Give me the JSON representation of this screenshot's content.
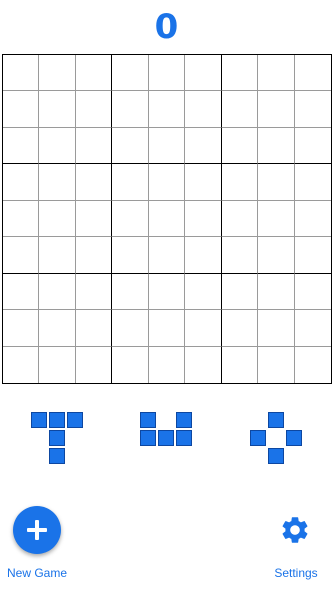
{
  "score": "0",
  "board": {
    "rows": 9,
    "cols": 9,
    "filled": []
  },
  "pieces": [
    {
      "name": "t-piece",
      "shape": [
        [
          1,
          1,
          1
        ],
        [
          0,
          1,
          0
        ],
        [
          0,
          1,
          0
        ]
      ]
    },
    {
      "name": "u-piece",
      "shape": [
        [
          1,
          0,
          1
        ],
        [
          1,
          1,
          1
        ]
      ]
    },
    {
      "name": "plus-ring-piece",
      "shape": [
        [
          0,
          1,
          0
        ],
        [
          1,
          0,
          1
        ],
        [
          0,
          1,
          0
        ]
      ]
    }
  ],
  "controls": {
    "new_game_label": "New Game",
    "settings_label": "Settings"
  },
  "colors": {
    "accent": "#1a73e8",
    "block_fill": "#1a73e8",
    "block_border": "#0d47a1"
  },
  "icons": {
    "new_game": "plus-icon",
    "settings": "gear-icon"
  }
}
